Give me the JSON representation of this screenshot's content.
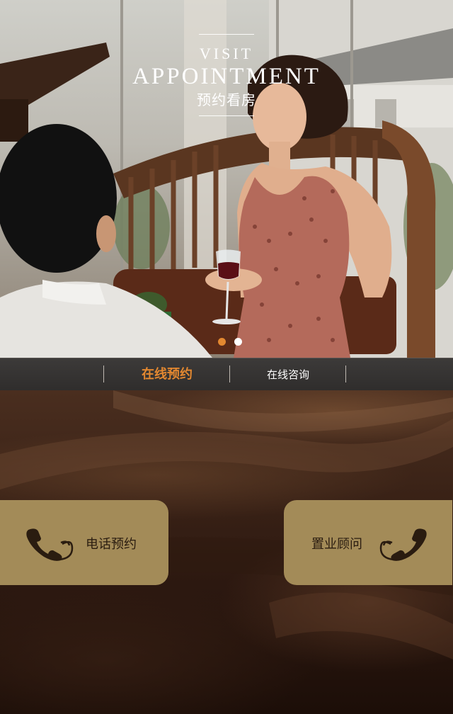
{
  "hero": {
    "title_en_small": "VISIT",
    "title_en_large": "APPOINTMENT",
    "title_cn": "预约看房",
    "carousel": {
      "slide_count": 2,
      "active_index": 0,
      "active_color": "#e38830",
      "inactive_color": "#ffffff"
    }
  },
  "tabs": [
    {
      "label": "在线预约",
      "active": true
    },
    {
      "label": "在线咨询",
      "active": false
    }
  ],
  "actions": {
    "phone_booking": {
      "label": "电话预约",
      "icon": "phone-icon"
    },
    "consultant": {
      "label": "置业顾问",
      "icon": "phone-icon"
    }
  },
  "colors": {
    "accent": "#e38830",
    "card": "#a38b58",
    "card_text": "#2a1c10"
  }
}
